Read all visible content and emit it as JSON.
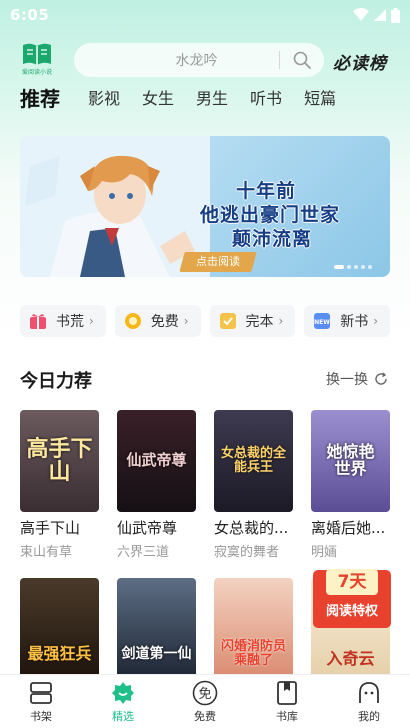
{
  "status": {
    "time": "6:05"
  },
  "header": {
    "logo_caption": "爱阅读小说",
    "search_placeholder": "水龙吟",
    "must_read_label": "必读榜"
  },
  "tabs": [
    "推荐",
    "影视",
    "女生",
    "男生",
    "听书",
    "短篇"
  ],
  "banner": {
    "line1": "十年前",
    "line2": "他逃出豪门世家",
    "line3": "颠沛流离",
    "button": "点击阅读"
  },
  "quick_links": [
    {
      "label": "书荒",
      "icon": "gift-icon",
      "color": "#f0506e"
    },
    {
      "label": "免费",
      "icon": "coin-icon",
      "color": "#f5b818"
    },
    {
      "label": "完本",
      "icon": "checkmark-icon",
      "color": "#f5c24a"
    },
    {
      "label": "新书",
      "icon": "new-icon",
      "color": "#5b8ef5"
    }
  ],
  "section": {
    "title": "今日力荐",
    "refresh_label": "换一换"
  },
  "books_row1": [
    {
      "title": "高手下山",
      "author": "束山有草",
      "cover_text": "高手下山",
      "bg": "#5a4a4e"
    },
    {
      "title": "仙武帝尊",
      "author": "六界三道",
      "cover_text": "仙武帝尊",
      "bg": "#241a20"
    },
    {
      "title": "女总裁的...",
      "author": "寂寞的舞者",
      "cover_text": "女总裁的全能兵王",
      "bg": "#2c2a3a"
    },
    {
      "title": "离婚后她...",
      "author": "明婳",
      "cover_text": "她惊艳世界",
      "bg": "#7b6fb0"
    }
  ],
  "books_row2": [
    {
      "cover_text": "最强狂兵",
      "bg": "#3a2a1a"
    },
    {
      "cover_text": "剑道第一仙",
      "bg": "#2a3445"
    },
    {
      "cover_text": "闪婚消防员 乘融了",
      "bg": "#e8b6a0"
    },
    {
      "cover_text": "入奇云",
      "bg": "#f3e6d0"
    }
  ],
  "promo": {
    "days": "7天",
    "text": "阅读特权"
  },
  "bottom_nav": [
    {
      "label": "书架",
      "icon": "bookshelf-icon"
    },
    {
      "label": "精选",
      "icon": "featured-icon"
    },
    {
      "label": "免费",
      "icon": "free-icon"
    },
    {
      "label": "书库",
      "icon": "library-icon"
    },
    {
      "label": "我的",
      "icon": "profile-icon"
    }
  ],
  "colors": {
    "accent": "#1fbf8a",
    "header_bg": "#bff0e1"
  }
}
